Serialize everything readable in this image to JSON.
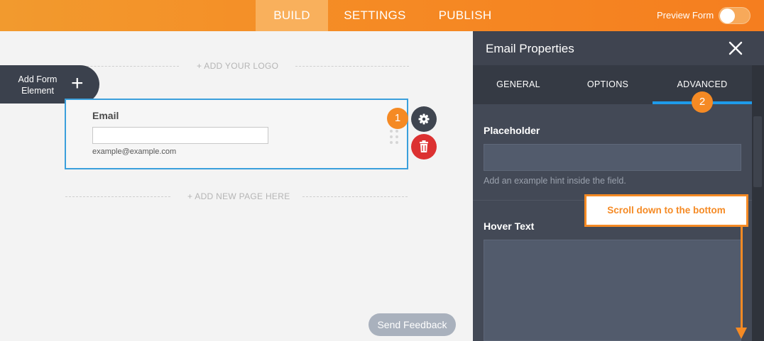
{
  "topbar": {
    "tabs": [
      "BUILD",
      "SETTINGS",
      "PUBLISH"
    ],
    "active_tab": "BUILD",
    "preview_label": "Preview Form",
    "preview_enabled": false
  },
  "canvas": {
    "add_logo": "+ ADD YOUR LOGO",
    "add_page": "+ ADD NEW PAGE HERE",
    "add_element_label": "Add Form Element",
    "add_element_icon": "plus-icon",
    "field": {
      "label": "Email",
      "value": "",
      "sublabel": "example@example.com"
    },
    "badge_1": "1",
    "feedback_label": "Send Feedback"
  },
  "panel": {
    "title": "Email Properties",
    "tabs": [
      "GENERAL",
      "OPTIONS",
      "ADVANCED"
    ],
    "active_tab": "ADVANCED",
    "badge_2": "2",
    "placeholder_label": "Placeholder",
    "placeholder_value": "",
    "placeholder_help": "Add an example hint inside the field.",
    "hover_label": "Hover Text",
    "hover_value": ""
  },
  "callout": {
    "text": "Scroll down to the bottom"
  },
  "colors": {
    "accent_orange": "#f58a24",
    "active_blue": "#1e9bea",
    "panel_bg": "#3f4450",
    "delete_red": "#dc3131"
  }
}
